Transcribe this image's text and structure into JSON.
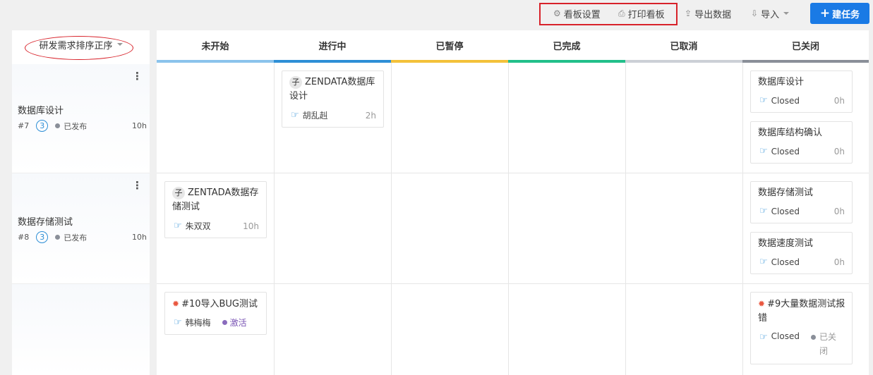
{
  "toolbar": {
    "settings_label": "看板设置",
    "print_label": "打印看板",
    "export_label": "导出数据",
    "import_label": "导入",
    "create_task_label": "建任务",
    "icons": [
      "gear-icon",
      "printer-icon",
      "export-icon",
      "import-icon",
      "plus-icon"
    ]
  },
  "lane_header": {
    "sort_label": "研发需求排序正序"
  },
  "columns": [
    {
      "label": "未开始",
      "color": "#8bc3ec"
    },
    {
      "label": "进行中",
      "color": "#2e8fd6"
    },
    {
      "label": "已暂停",
      "color": "#f3c13a"
    },
    {
      "label": "已完成",
      "color": "#22bf8a"
    },
    {
      "label": "已取消",
      "color": "#ccd0d6"
    },
    {
      "label": "已关闭",
      "color": "#8a8f99"
    }
  ],
  "lanes": [
    {
      "title": "数据库设计",
      "id": "#7",
      "priority": "3",
      "status": "已发布",
      "hours": "10h"
    },
    {
      "title": "数据存储测试",
      "id": "#8",
      "priority": "3",
      "status": "已发布",
      "hours": "10h"
    },
    {
      "title": "",
      "id": "",
      "priority": "",
      "status": "",
      "hours": ""
    }
  ],
  "cards": {
    "c1": {
      "badge": "子",
      "title": "ZENDATA数据库设计",
      "assignee": "胡乱赳",
      "hours": "2h"
    },
    "c2": {
      "title": "数据库设计",
      "assignee": "Closed",
      "hours": "0h"
    },
    "c3": {
      "title": "数据库结构确认",
      "assignee": "Closed",
      "hours": "0h"
    },
    "c4": {
      "badge": "子",
      "title": "ZENTADA数据存储测试",
      "assignee": "朱双双",
      "hours": "10h"
    },
    "c5": {
      "title": "数据存储测试",
      "assignee": "Closed",
      "hours": "0h"
    },
    "c6": {
      "title": "数据速度测试",
      "assignee": "Closed",
      "hours": "0h"
    },
    "c7": {
      "title": "#10导入BUG测试",
      "assignee": "韩梅梅",
      "status": "激活"
    },
    "c8": {
      "title": "#9大量数据测试报错",
      "assignee": "Closed",
      "status": "已关闭"
    }
  }
}
